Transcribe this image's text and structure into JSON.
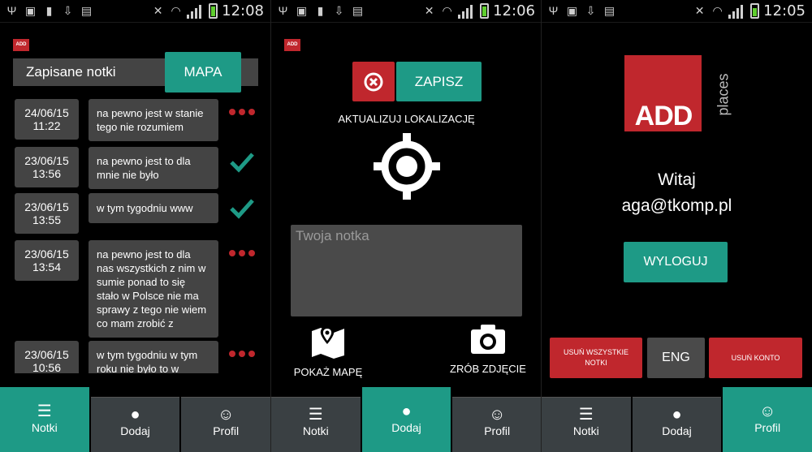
{
  "colors": {
    "accent": "#1e9a86",
    "danger": "#c0272d",
    "panel": "#444444",
    "tab": "#3a4043"
  },
  "app_logo": "ADD",
  "statusbar": [
    {
      "time": "12:08",
      "battery": 0.9
    },
    {
      "time": "12:06",
      "battery": 0.9
    },
    {
      "time": "12:05",
      "battery": 0.8
    }
  ],
  "tabs": [
    {
      "label": "Notki",
      "icon": "list-icon"
    },
    {
      "label": "Dodaj",
      "icon": "location-pin-icon"
    },
    {
      "label": "Profil",
      "icon": "profile-face-icon"
    }
  ],
  "notes_screen": {
    "title": "Zapisane notki",
    "map_button": "MAPA",
    "notes": [
      {
        "date": "24/06/15",
        "time": "11:22",
        "text": "na pewno jest w stanie tego nie rozumiem",
        "status": "pending"
      },
      {
        "date": "23/06/15",
        "time": "13:56",
        "text": "na pewno jest to dla mnie nie było",
        "status": "synced"
      },
      {
        "date": "23/06/15",
        "time": "13:55",
        "text": "w tym tygodniu www",
        "status": "synced"
      },
      {
        "date": "23/06/15",
        "time": "13:54",
        "text": "na pewno jest to dla nas wszystkich z nim w sumie ponad to się stało w Polsce nie ma sprawy z tego nie wiem co mam zrobić z",
        "status": "pending"
      },
      {
        "date": "23/06/15",
        "time": "10:56",
        "text": "w tym tygodniu w tym roku nie było to w",
        "status": "pending"
      }
    ]
  },
  "add_screen": {
    "save_button": "ZAPISZ",
    "update_location": "AKTUALIZUJ LOKALIZACJĘ",
    "note_placeholder": "Twoja notka",
    "show_map": "POKAŻ MAPĘ",
    "take_photo": "ZRÓB ZDJĘCIE"
  },
  "profile_screen": {
    "logo_main": "ADD",
    "logo_side": "places",
    "welcome": "Witaj",
    "email": "aga@tkomp.pl",
    "logout_button": "WYLOGUJ",
    "delete_all_notes": "USUŃ WSZYSTKIE NOTKI",
    "language_button": "ENG",
    "delete_account": "USUŃ KONTO"
  }
}
